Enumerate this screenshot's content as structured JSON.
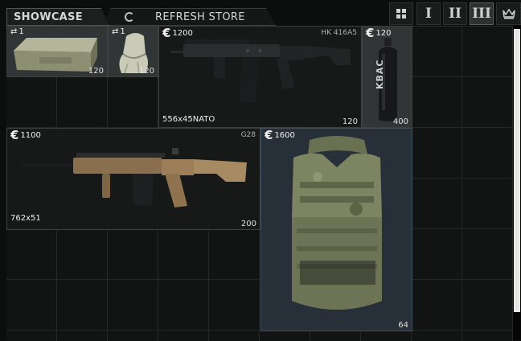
{
  "tabs": {
    "showcase": "SHOWCASE",
    "refresh": "REFRESH STORE"
  },
  "tier_buttons": [
    {
      "icon": "grid-icon",
      "label": ""
    },
    {
      "icon": "",
      "label": "I"
    },
    {
      "icon": "",
      "label": "II"
    },
    {
      "icon": "",
      "label": "III",
      "selected": true
    },
    {
      "icon": "crown-icon",
      "label": ""
    }
  ],
  "items": {
    "soap": {
      "swap_icon": "⇄",
      "price": "1",
      "quantity": "120"
    },
    "cloth": {
      "swap_icon": "⇄",
      "price": "1",
      "quantity": "120"
    },
    "hk416": {
      "currency": "€",
      "price": "1200",
      "name": "HK 416A5",
      "caliber": "556x45NATO",
      "quantity": "120"
    },
    "kbac": {
      "currency": "€",
      "price": "120",
      "label": "KBAC",
      "quantity": "400"
    },
    "g28": {
      "currency": "€",
      "price": "1100",
      "name": "G28",
      "caliber": "762x51",
      "quantity": "200"
    },
    "armor": {
      "currency": "€",
      "price": "1600",
      "quantity": "64"
    }
  }
}
